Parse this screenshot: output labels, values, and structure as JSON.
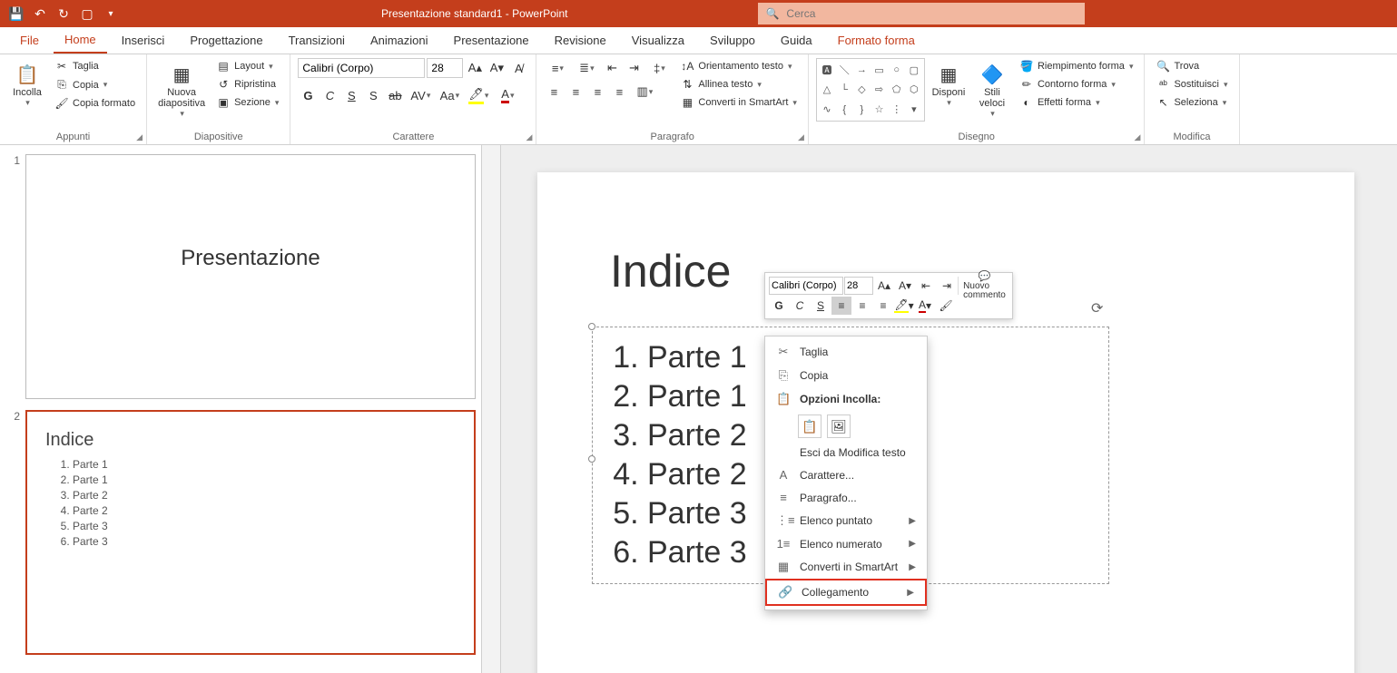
{
  "app": {
    "title": "Presentazione standard1  -  PowerPoint",
    "search_placeholder": "Cerca"
  },
  "tabs": {
    "file": "File",
    "home": "Home",
    "inserisci": "Inserisci",
    "progettazione": "Progettazione",
    "transizioni": "Transizioni",
    "animazioni": "Animazioni",
    "presentazione": "Presentazione",
    "revisione": "Revisione",
    "visualizza": "Visualizza",
    "sviluppo": "Sviluppo",
    "guida": "Guida",
    "formato_forma": "Formato forma"
  },
  "ribbon": {
    "appunti": {
      "label": "Appunti",
      "incolla": "Incolla",
      "taglia": "Taglia",
      "copia": "Copia",
      "copia_formato": "Copia formato"
    },
    "diapositive": {
      "label": "Diapositive",
      "nuova": "Nuova diapositiva",
      "layout": "Layout",
      "ripristina": "Ripristina",
      "sezione": "Sezione"
    },
    "carattere": {
      "label": "Carattere",
      "font": "Calibri (Corpo)",
      "size": "28"
    },
    "paragrafo": {
      "label": "Paragrafo",
      "orientamento": "Orientamento testo",
      "allinea": "Allinea testo",
      "smartart": "Converti in SmartArt"
    },
    "disegno": {
      "label": "Disegno",
      "disponi": "Disponi",
      "stili": "Stili veloci",
      "riempimento": "Riempimento forma",
      "contorno": "Contorno forma",
      "effetti": "Effetti forma"
    },
    "modifica": {
      "label": "Modifica",
      "trova": "Trova",
      "sostituisci": "Sostituisci",
      "seleziona": "Seleziona"
    }
  },
  "thumbs": {
    "s1_title": "Presentazione",
    "s2_title": "Indice",
    "s2_items": [
      "Parte 1",
      "Parte 1",
      "Parte 2",
      "Parte 2",
      "Parte 3",
      "Parte 3"
    ]
  },
  "slide": {
    "title": "Indice",
    "items": [
      "Parte 1",
      "Parte 1",
      "Parte 2",
      "Parte 2",
      "Parte 3",
      "Parte 3"
    ]
  },
  "mini_toolbar": {
    "font": "Calibri (Corpo)",
    "size": "28",
    "nuovo_commento": "Nuovo commento"
  },
  "context_menu": {
    "taglia": "Taglia",
    "copia": "Copia",
    "opzioni_incolla": "Opzioni Incolla:",
    "esci": "Esci da Modifica testo",
    "carattere": "Carattere...",
    "paragrafo": "Paragrafo...",
    "elenco_puntato": "Elenco puntato",
    "elenco_numerato": "Elenco numerato",
    "smartart": "Converti in SmartArt",
    "collegamento": "Collegamento"
  }
}
